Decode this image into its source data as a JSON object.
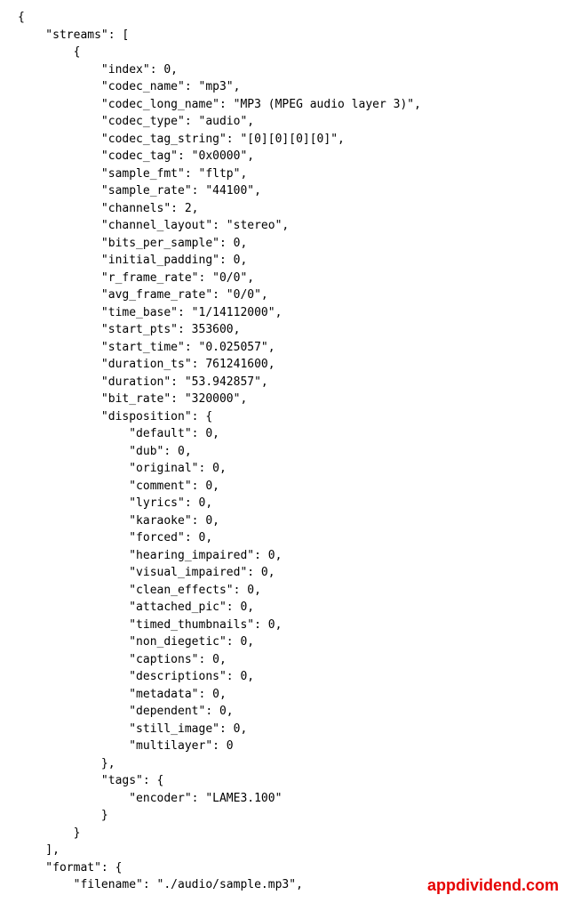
{
  "watermark": "appdividend.com",
  "lines": [
    "{",
    "    \"streams\": [",
    "        {",
    "            \"index\": 0,",
    "            \"codec_name\": \"mp3\",",
    "            \"codec_long_name\": \"MP3 (MPEG audio layer 3)\",",
    "            \"codec_type\": \"audio\",",
    "            \"codec_tag_string\": \"[0][0][0][0]\",",
    "            \"codec_tag\": \"0x0000\",",
    "            \"sample_fmt\": \"fltp\",",
    "            \"sample_rate\": \"44100\",",
    "            \"channels\": 2,",
    "            \"channel_layout\": \"stereo\",",
    "            \"bits_per_sample\": 0,",
    "            \"initial_padding\": 0,",
    "            \"r_frame_rate\": \"0/0\",",
    "            \"avg_frame_rate\": \"0/0\",",
    "            \"time_base\": \"1/14112000\",",
    "            \"start_pts\": 353600,",
    "            \"start_time\": \"0.025057\",",
    "            \"duration_ts\": 761241600,",
    "            \"duration\": \"53.942857\",",
    "            \"bit_rate\": \"320000\",",
    "            \"disposition\": {",
    "                \"default\": 0,",
    "                \"dub\": 0,",
    "                \"original\": 0,",
    "                \"comment\": 0,",
    "                \"lyrics\": 0,",
    "                \"karaoke\": 0,",
    "                \"forced\": 0,",
    "                \"hearing_impaired\": 0,",
    "                \"visual_impaired\": 0,",
    "                \"clean_effects\": 0,",
    "                \"attached_pic\": 0,",
    "                \"timed_thumbnails\": 0,",
    "                \"non_diegetic\": 0,",
    "                \"captions\": 0,",
    "                \"descriptions\": 0,",
    "                \"metadata\": 0,",
    "                \"dependent\": 0,",
    "                \"still_image\": 0,",
    "                \"multilayer\": 0",
    "            },",
    "            \"tags\": {",
    "                \"encoder\": \"LAME3.100\"",
    "            }",
    "        }",
    "    ],",
    "    \"format\": {",
    "        \"filename\": \"./audio/sample.mp3\","
  ]
}
